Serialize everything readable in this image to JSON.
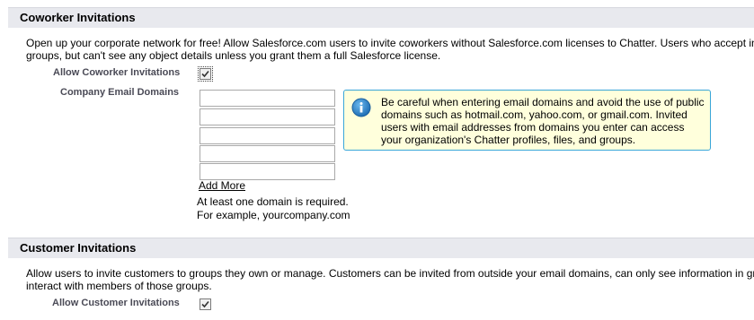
{
  "coworker_section": {
    "title": "Coworker Invitations",
    "description_line1": "Open up your corporate network for free! Allow Salesforce.com users to invite coworkers without Salesforce.com licenses to Chatter. Users who accept in",
    "description_line2": "groups, but can't see any object details unless you grant them a full Salesforce license.",
    "allow_label": "Allow Coworker Invitations",
    "allow_checked": true,
    "domains_label": "Company Email Domains",
    "domain_inputs": [
      "",
      "",
      "",
      "",
      ""
    ],
    "add_more_label": "Add More",
    "hint_line1": "At least one domain is required.",
    "hint_line2": "For example, yourcompany.com",
    "info_icon": "info-icon",
    "info_text": "Be careful when entering email domains and avoid the use of public domains such as hotmail.com, yahoo.com, or gmail.com. Invited users with email addresses from domains you enter can access your organization's Chatter profiles, files, and groups."
  },
  "customer_section": {
    "title": "Customer Invitations",
    "description_line1": "Allow users to invite customers to groups they own or manage. Customers can be invited from outside your email domains, can only see information in gr",
    "description_line2": "interact with members of those groups.",
    "allow_label": "Allow Customer Invitations",
    "allow_checked": true
  },
  "colors": {
    "section_header_bg": "#e8e9ee",
    "info_box_bg": "#ffffdc",
    "info_box_border": "#39a6d8",
    "info_icon": "#2a82c9"
  }
}
